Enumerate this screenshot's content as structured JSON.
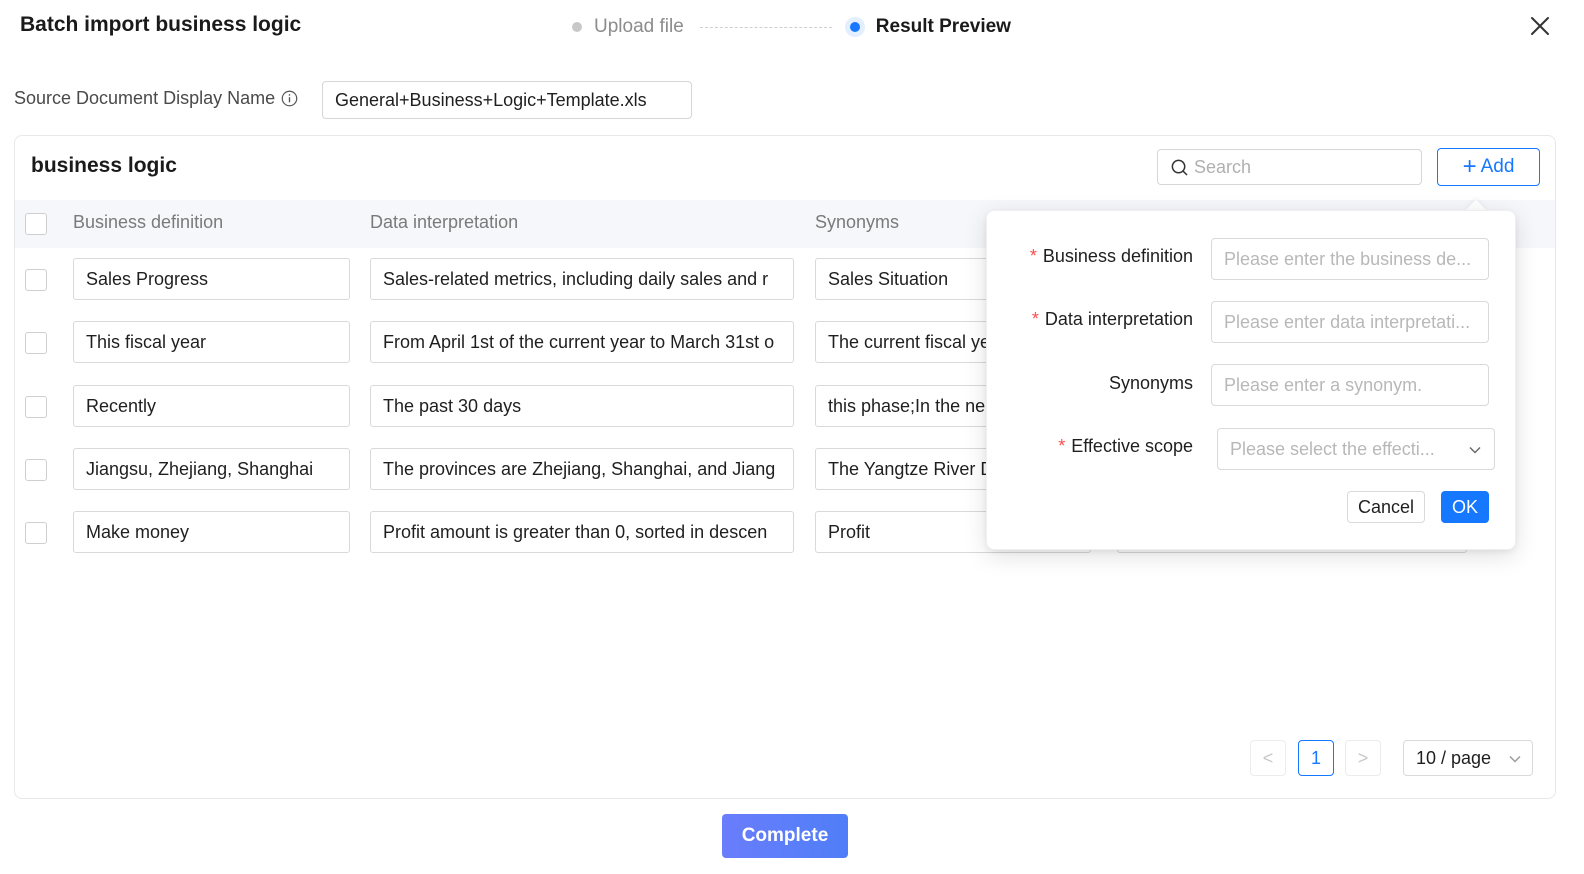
{
  "modal": {
    "title": "Batch import business logic",
    "steps": [
      {
        "label": "Upload file",
        "state": "inactive"
      },
      {
        "label": "Result Preview",
        "state": "active"
      }
    ]
  },
  "source": {
    "label": "Source Document Display Name",
    "value": "General+Business+Logic+Template.xls"
  },
  "card": {
    "title": "business logic",
    "search_placeholder": "Search",
    "add_label": "Add"
  },
  "table": {
    "columns": [
      "Business definition",
      "Data interpretation",
      "Synonyms"
    ],
    "rows": [
      {
        "definition": "Sales Progress",
        "interpretation": "Sales-related metrics, including daily sales and r",
        "synonyms": "Sales Situation"
      },
      {
        "definition": "This fiscal year",
        "interpretation": "From April 1st of the current year to March 31st o",
        "synonyms": "The current fiscal ye"
      },
      {
        "definition": "Recently",
        "interpretation": "The past 30 days",
        "synonyms": "this phase;In the ne"
      },
      {
        "definition": "Jiangsu, Zhejiang, Shanghai",
        "interpretation": "The provinces are Zhejiang, Shanghai, and Jiang",
        "synonyms": "The Yangtze River D"
      },
      {
        "definition": "Make money",
        "interpretation": "Profit amount is greater than 0, sorted in descen",
        "synonyms": "Profit"
      }
    ]
  },
  "pagination": {
    "prev": "<",
    "current": "1",
    "next": ">",
    "page_size": "10 / page"
  },
  "popover": {
    "fields": [
      {
        "label": "Business definition",
        "required": true,
        "placeholder": "Please enter the business de..."
      },
      {
        "label": "Data interpretation",
        "required": true,
        "placeholder": "Please enter data interpretati..."
      },
      {
        "label": "Synonyms",
        "required": false,
        "placeholder": "Please enter a synonym."
      },
      {
        "label": "Effective scope",
        "required": true,
        "placeholder": "Please select the effecti..."
      }
    ],
    "required_mark": "*",
    "cancel_label": "Cancel",
    "ok_label": "OK"
  },
  "footer": {
    "complete_label": "Complete"
  },
  "colors": {
    "primary": "#1677ff",
    "required": "#ff4d4f",
    "complete_button": "#5c7cfa"
  }
}
